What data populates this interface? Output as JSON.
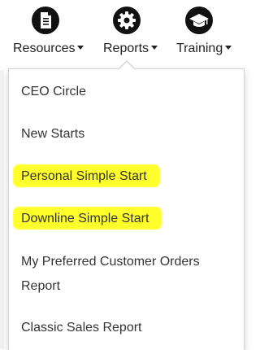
{
  "nav": {
    "items": [
      {
        "label": "Resources",
        "icon": "document-icon"
      },
      {
        "label": "Reports",
        "icon": "gear-icon"
      },
      {
        "label": "Training",
        "icon": "graduation-cap-icon"
      }
    ]
  },
  "menu": {
    "items": [
      {
        "label": "CEO Circle",
        "highlighted": false
      },
      {
        "label": "New Starts",
        "highlighted": false
      },
      {
        "label": "Personal Simple Start",
        "highlighted": true
      },
      {
        "label": "Downline Simple Start",
        "highlighted": true
      },
      {
        "label": "My Preferred Customer Orders",
        "label_line2": "Report",
        "highlighted": false
      },
      {
        "label": "Classic Sales Report",
        "highlighted": false
      }
    ]
  },
  "colors": {
    "highlight": "#ffff2b",
    "icon_bg": "#111111"
  }
}
